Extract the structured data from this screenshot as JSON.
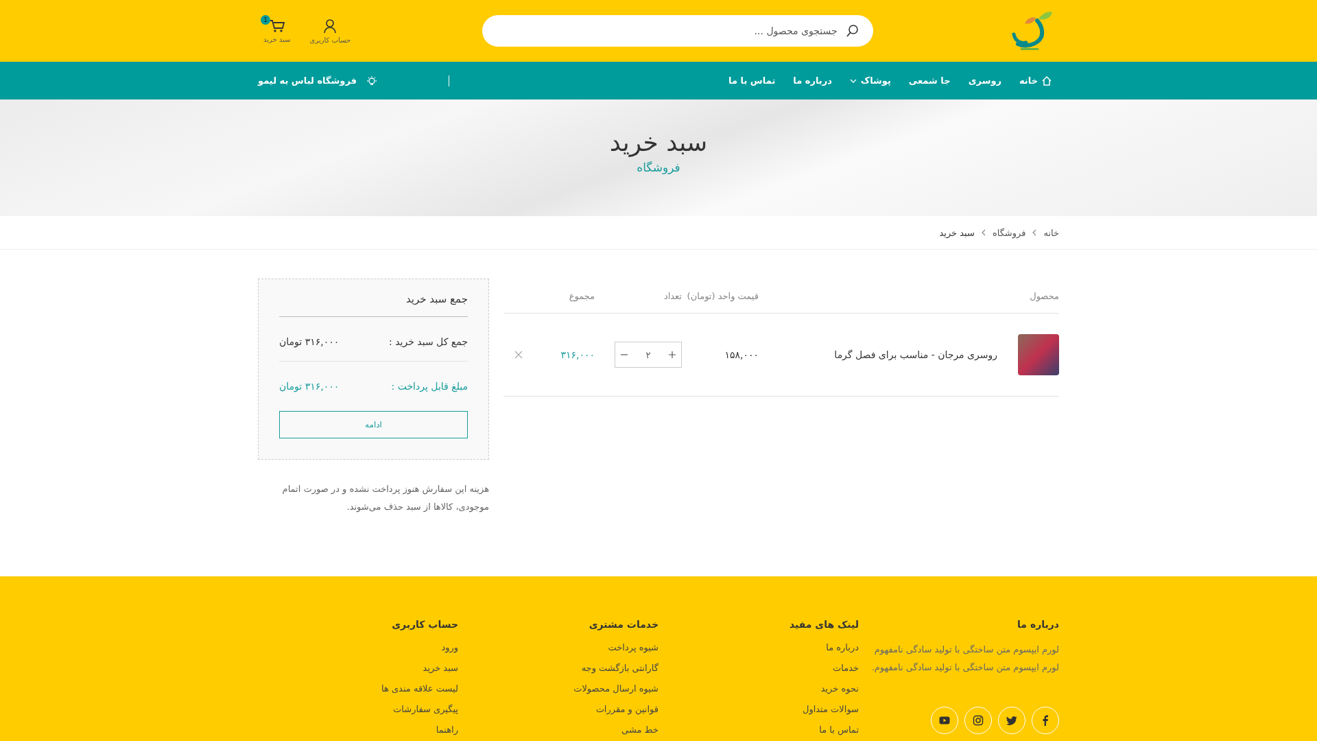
{
  "header": {
    "search": {
      "placeholder": "جستجوی محصول ..."
    },
    "account": {
      "label": "حساب کاربری"
    },
    "cart": {
      "label": "سبد خرید",
      "count": "1"
    }
  },
  "nav": {
    "items": [
      {
        "label": "خانه",
        "kind": "home"
      },
      {
        "label": "روسری",
        "kind": "link"
      },
      {
        "label": "جا شمعی",
        "kind": "link"
      },
      {
        "label": "پوشاک",
        "kind": "dropdown"
      },
      {
        "label": "درباره ما",
        "kind": "link"
      },
      {
        "label": "تماس با ما",
        "kind": "link"
      }
    ],
    "promo": "فروشگاه لباس به لیمو"
  },
  "hero": {
    "title": "سبد خرید",
    "subtitle": "فروشگاه"
  },
  "breadcrumb": [
    "خانه",
    "فروشگاه",
    "سبد خرید"
  ],
  "cart": {
    "columns": [
      "محصول",
      "قیمت واحد (تومان)",
      "تعداد",
      "مجموع"
    ],
    "rows": [
      {
        "name": "روسری مرجان - مناسب برای فصل گرما",
        "unit_price": "۱۵۸,۰۰۰",
        "quantity": "۲",
        "total": "۳۱۶,۰۰۰"
      }
    ]
  },
  "totals": {
    "title": "جمع سبد خرید",
    "subtotal_label": "جمع کل سبد خرید :",
    "subtotal": "۳۱۶,۰۰۰ تومان",
    "payable_label": "مبلغ قابل پرداخت :",
    "payable": "۳۱۶,۰۰۰ تومان",
    "button": "ادامه"
  },
  "note": "هزینه این سفارش هنوز پرداخت نشده و در صورت اتمام موجودی، کالاها از سبد حذف می‌شوند.",
  "footer": {
    "about": {
      "title": "درباره ما",
      "text": "لورم ایپسوم متن ساختگی با تولید سادگی نامفهوم لورم ایپسوم متن ساختگی با تولید سادگی نامفهوم.",
      "social": [
        {
          "kind": "facebook"
        },
        {
          "kind": "twitter"
        },
        {
          "kind": "instagram"
        },
        {
          "kind": "youtube"
        }
      ]
    },
    "columns": [
      {
        "title": "لینک های مفید",
        "links": [
          "درباره ما",
          "خدمات",
          "نحوه خرید",
          "سوالات متداول",
          "تماس با ما"
        ]
      },
      {
        "title": "خدمات مشتری",
        "links": [
          "شیوه پرداخت",
          "گارانتی بازگشت وجه",
          "شیوه ارسال محصولات",
          "قوانین و مقررات",
          "خط مشی"
        ]
      },
      {
        "title": "حساب کاربری",
        "links": [
          "ورود",
          "سبد خرید",
          "لیست علاقه مندی ها",
          "پیگیری سفارشات",
          "راهنما"
        ]
      }
    ]
  }
}
